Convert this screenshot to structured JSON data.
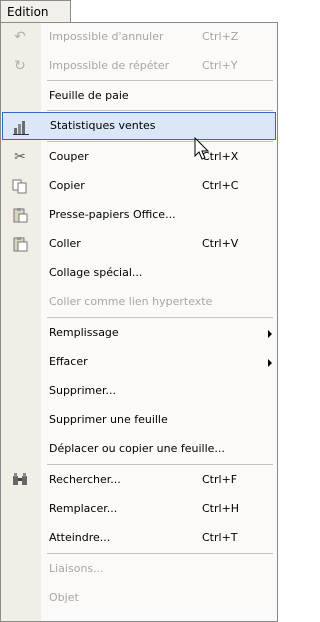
{
  "menubar": {
    "title": "Edition"
  },
  "items": [
    {
      "label": "Impossible d'annuler",
      "shortcut": "Ctrl+Z",
      "icon": "undo-icon",
      "enabled": false
    },
    {
      "label": "Impossible de répéter",
      "shortcut": "Ctrl+Y",
      "icon": "redo-icon",
      "enabled": false
    },
    {
      "label": "Feuille de paie",
      "shortcut": "",
      "icon": "",
      "enabled": true
    },
    {
      "label": "Statistiques ventes",
      "shortcut": "",
      "icon": "bar-chart-icon",
      "enabled": true,
      "highlighted": true
    },
    {
      "label": "Couper",
      "shortcut": "Ctrl+X",
      "icon": "scissors-icon",
      "enabled": true
    },
    {
      "label": "Copier",
      "shortcut": "Ctrl+C",
      "icon": "copy-icon",
      "enabled": true
    },
    {
      "label": "Presse-papiers Office...",
      "shortcut": "",
      "icon": "clipboard-office-icon",
      "enabled": true
    },
    {
      "label": "Coller",
      "shortcut": "Ctrl+V",
      "icon": "paste-icon",
      "enabled": true
    },
    {
      "label": "Collage spécial...",
      "shortcut": "",
      "icon": "",
      "enabled": true
    },
    {
      "label": "Coller comme lien hypertexte",
      "shortcut": "",
      "icon": "",
      "enabled": false
    },
    {
      "label": "Remplissage",
      "shortcut": "",
      "icon": "",
      "enabled": true,
      "submenu": true
    },
    {
      "label": "Effacer",
      "shortcut": "",
      "icon": "",
      "enabled": true,
      "submenu": true
    },
    {
      "label": "Supprimer...",
      "shortcut": "",
      "icon": "",
      "enabled": true
    },
    {
      "label": "Supprimer une feuille",
      "shortcut": "",
      "icon": "",
      "enabled": true
    },
    {
      "label": "Déplacer ou copier une feuille...",
      "shortcut": "",
      "icon": "",
      "enabled": true
    },
    {
      "label": "Rechercher...",
      "shortcut": "Ctrl+F",
      "icon": "binoculars-icon",
      "enabled": true
    },
    {
      "label": "Remplacer...",
      "shortcut": "Ctrl+H",
      "icon": "",
      "enabled": true
    },
    {
      "label": "Atteindre...",
      "shortcut": "Ctrl+T",
      "icon": "",
      "enabled": true
    },
    {
      "label": "Liaisons...",
      "shortcut": "",
      "icon": "",
      "enabled": false
    },
    {
      "label": "Objet",
      "shortcut": "",
      "icon": "",
      "enabled": false
    }
  ]
}
